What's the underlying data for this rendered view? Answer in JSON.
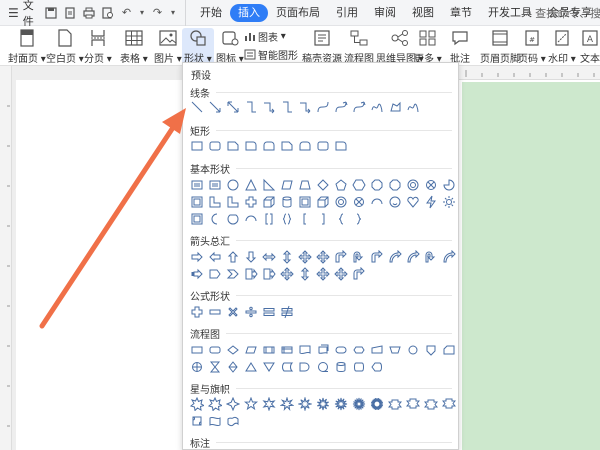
{
  "menubar": {
    "file_label": "文件",
    "tabs": [
      "开始",
      "插入",
      "页面布局",
      "引用",
      "审阅",
      "视图",
      "章节",
      "开发工具",
      "会员专享"
    ],
    "active_tab": "插入",
    "search_placeholder": "查找命令、搜索模板"
  },
  "ribbon": {
    "cover_page": "封面页",
    "blank_page": "空白页",
    "page_break": "分页",
    "table": "表格",
    "picture": "图片",
    "shapes": "形状",
    "icons": "图标",
    "chart": "图表",
    "smart_art": "智能图形",
    "draft_resources": "稿壳资源",
    "flowchart": "流程图",
    "mind_map": "思维导图",
    "more": "更多",
    "comment": "批注",
    "header_footer": "页眉页脚",
    "page_number": "页码",
    "watermark": "水印",
    "text_box": "文本"
  },
  "panel": {
    "preset": "预设",
    "sections": {
      "lines": "线条",
      "rectangles": "矩形",
      "basic": "基本形状",
      "arrows": "箭头总汇",
      "equation": "公式形状",
      "flowchart": "流程图",
      "stars": "星与旗帜",
      "callouts": "标注"
    }
  },
  "colors": {
    "accent": "#2f7df6",
    "arrow": "#f07048",
    "doc_green": "#cde8cd"
  }
}
